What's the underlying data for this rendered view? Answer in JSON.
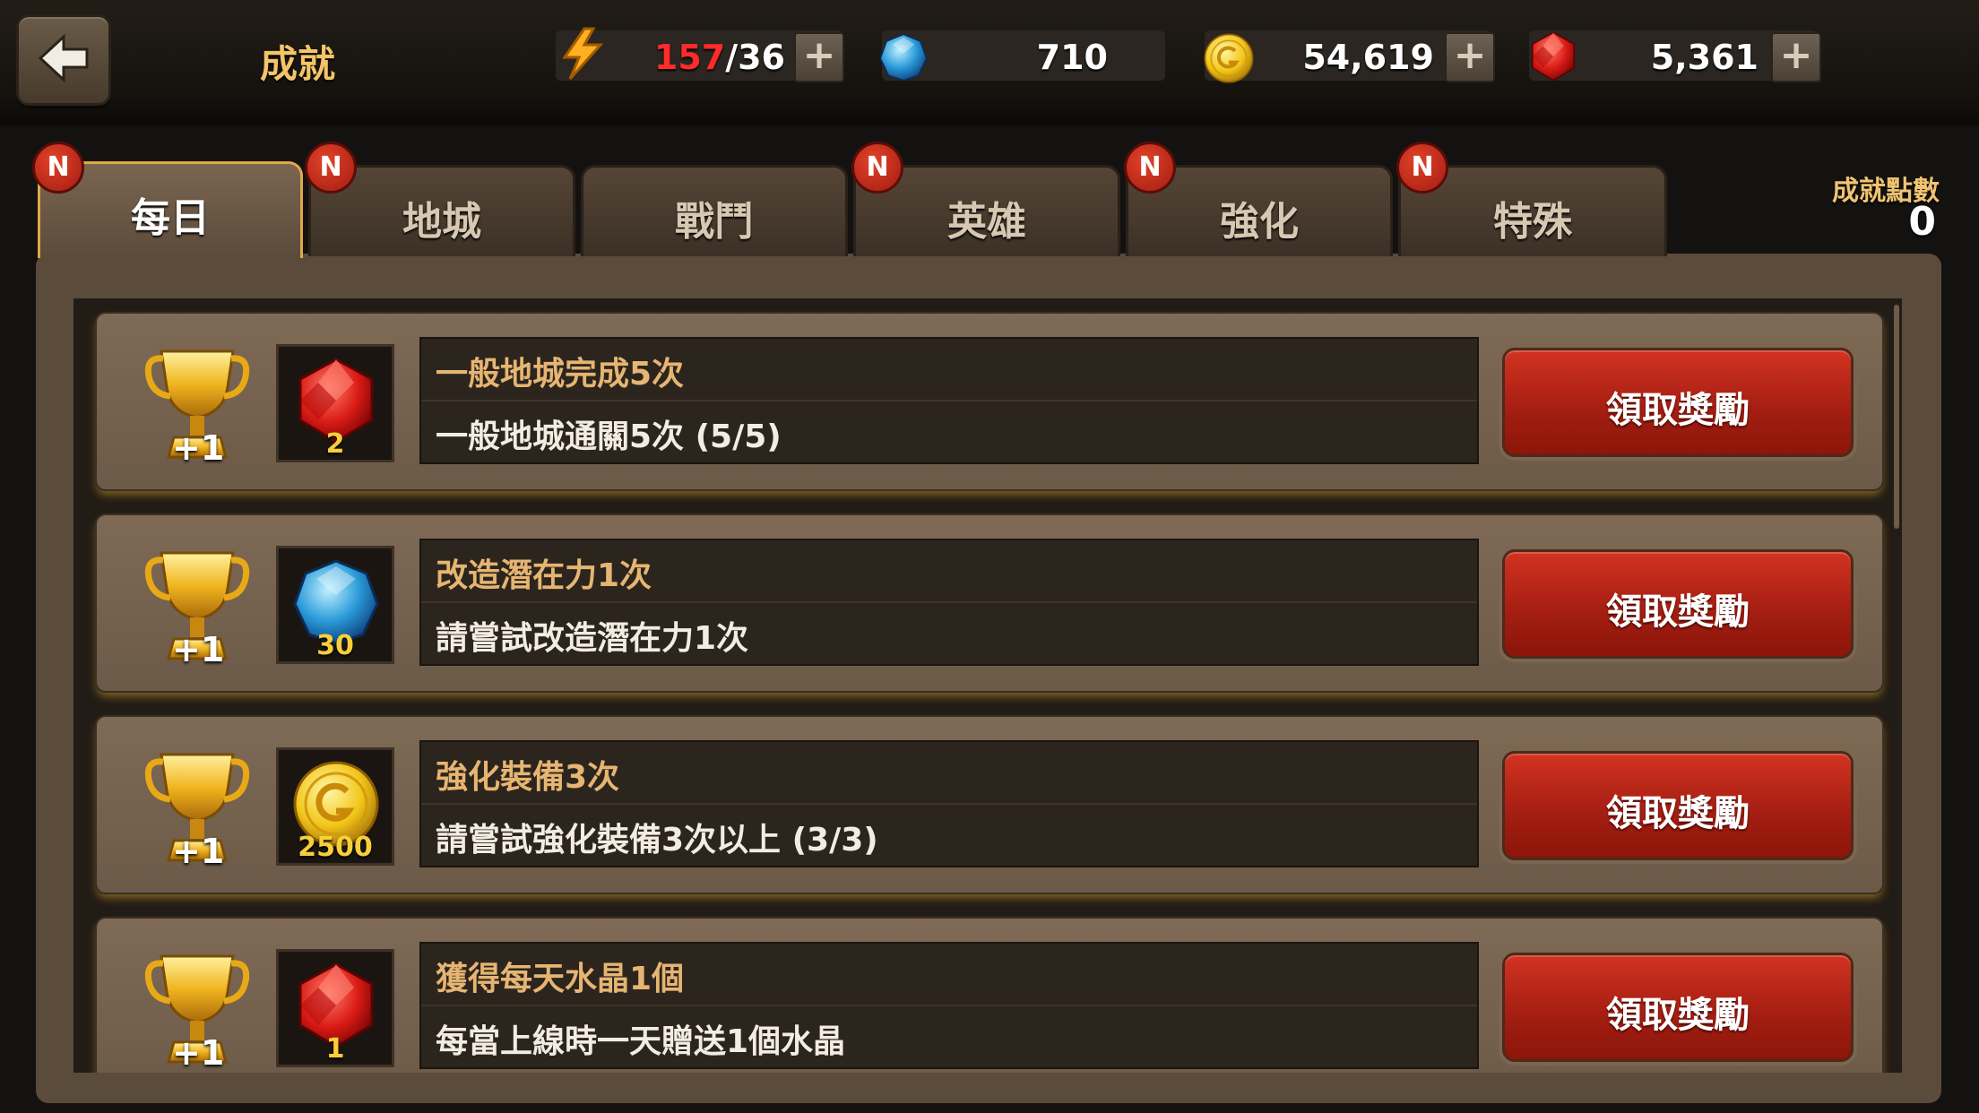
{
  "header": {
    "back_icon": "arrow-left-icon",
    "title": "成就",
    "stamina": {
      "icon": "lightning-icon",
      "current": "157",
      "max": "/36"
    },
    "blue_gem": {
      "icon": "blue-gem-icon",
      "value": "710"
    },
    "gold": {
      "icon": "gold-coin-icon",
      "value": "54,619"
    },
    "ruby": {
      "icon": "ruby-icon",
      "value": "5,361"
    },
    "plus_label": "+"
  },
  "tabs": [
    {
      "label": "每日",
      "badge": "N",
      "active": true
    },
    {
      "label": "地城",
      "badge": "N"
    },
    {
      "label": "戰鬥",
      "badge": ""
    },
    {
      "label": "英雄",
      "badge": "N"
    },
    {
      "label": "強化",
      "badge": "N"
    },
    {
      "label": "特殊",
      "badge": "N"
    }
  ],
  "points": {
    "label": "成就點數",
    "value": "0"
  },
  "achievements": [
    {
      "trophy_bonus": "+1",
      "reward_icon": "ruby-icon",
      "reward_qty": "2",
      "title": "一般地城完成5次",
      "desc": "一般地城通關5次 (5/5)",
      "button": "領取獎勵"
    },
    {
      "trophy_bonus": "+1",
      "reward_icon": "blue-gem-icon",
      "reward_qty": "30",
      "title": "改造潛在力1次",
      "desc": "請嘗試改造潛在力1次",
      "button": "領取獎勵"
    },
    {
      "trophy_bonus": "+1",
      "reward_icon": "gold-coin-icon",
      "reward_qty": "2500",
      "title": "強化裝備3次",
      "desc": "請嘗試強化裝備3次以上 (3/3)",
      "button": "領取獎勵"
    },
    {
      "trophy_bonus": "+1",
      "reward_icon": "ruby-icon",
      "reward_qty": "1",
      "title": "獲得每天水晶1個",
      "desc": "每當上線時一天贈送1個水晶",
      "button": "領取獎勵"
    }
  ],
  "colors": {
    "accent_gold": "#f3c46a",
    "button_red": "#c0281a",
    "stamina_red": "#ff2a2a"
  }
}
